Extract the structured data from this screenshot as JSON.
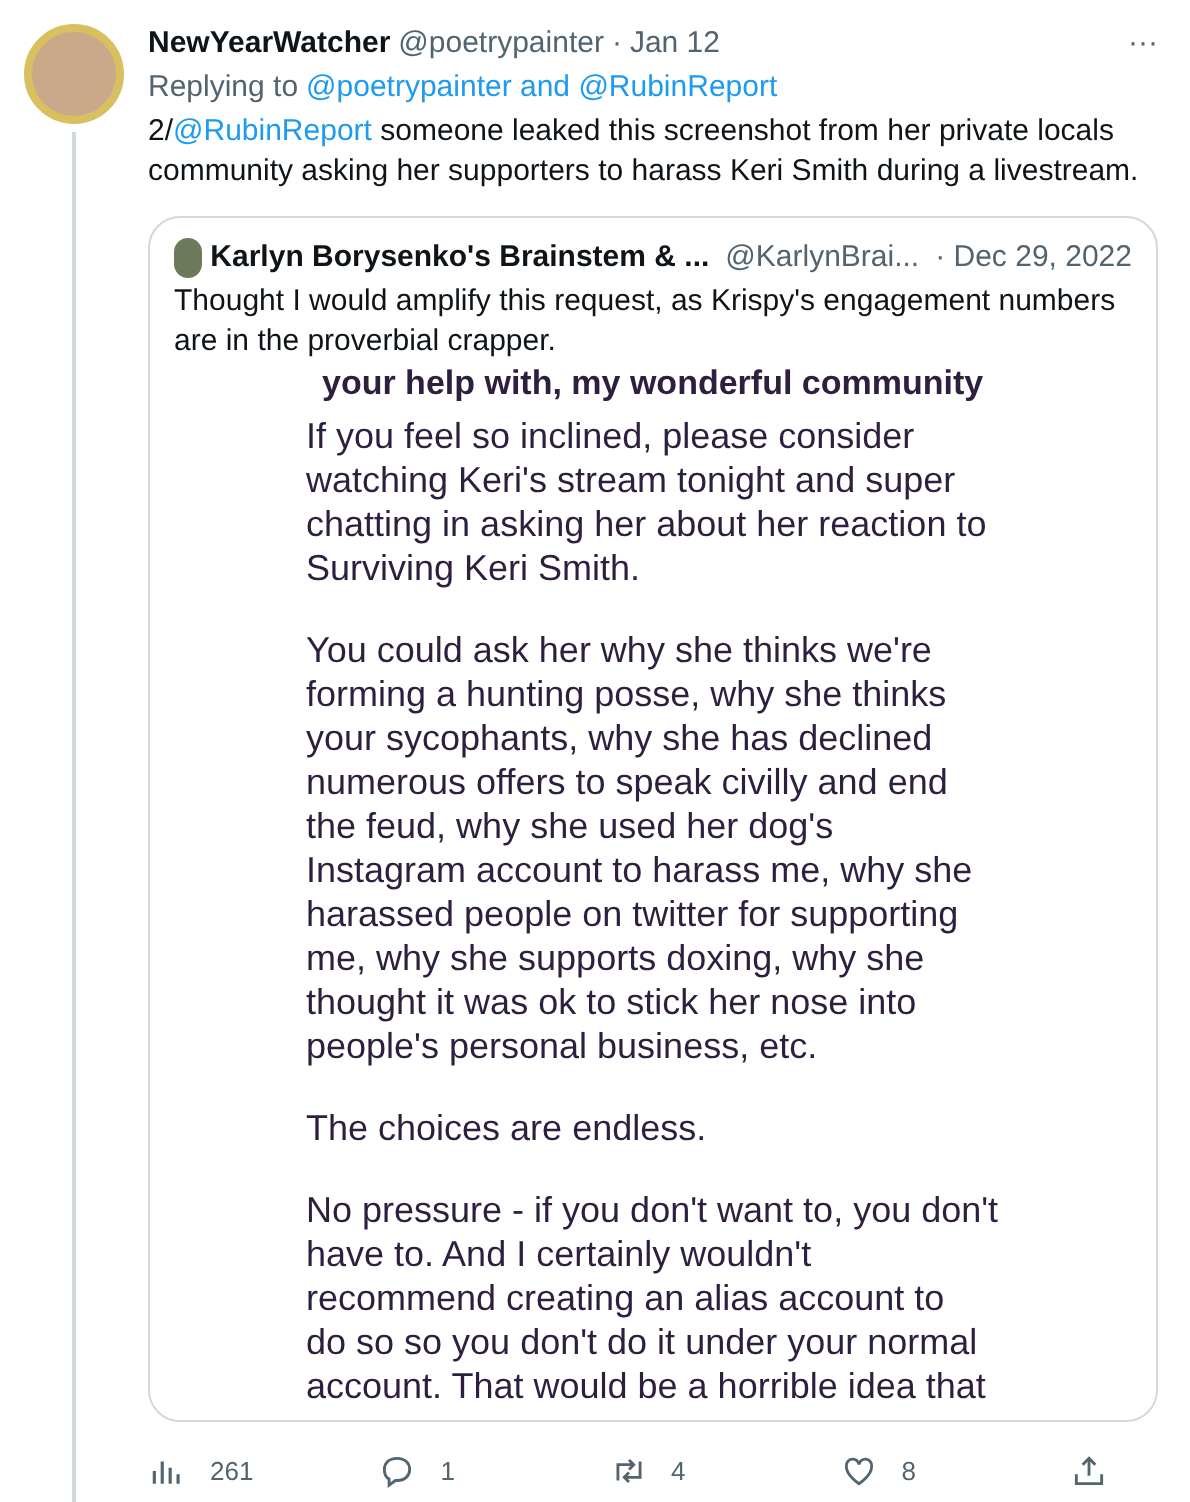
{
  "tweet": {
    "author": "NewYearWatcher",
    "handle": "@poetrypainter",
    "separator": "·",
    "date": "Jan 12",
    "more": "···",
    "replying_prefix": "Replying to",
    "replying_to": "@poetrypainter and @RubinReport",
    "text": "2/",
    "text_mention": "@RubinReport",
    "text_rest": " someone leaked this screenshot from her private locals community asking her supporters to harass Keri Smith during a livestream.",
    "quote": {
      "author": "Karlyn Borysenko's Brainstem & ...",
      "handle": "@KarlynBrai...",
      "date": "· Dec 29, 2022",
      "text": "Thought I would amplify this request, as Krispy's engagement numbers are in the proverbial crapper.",
      "image_paragraphs": [
        {
          "lines": [
            "your help with, my wonderful community"
          ]
        },
        {
          "lines": [
            "If you feel so inclined, please consider",
            "watching Keri's stream tonight and super",
            "chatting in asking her about her reaction to",
            "Surviving Keri Smith."
          ]
        },
        {
          "lines": [
            "You could ask her why she thinks we're",
            "forming a hunting posse, why she thinks",
            "your sycophants, why she has declined",
            "numerous offers to speak civilly and end",
            "the feud, why she used her dog's",
            "Instagram account to harass me, why she",
            "harassed people on twitter for supporting",
            "me, why she supports doxing, why she",
            "thought it was ok to stick her nose into",
            "people's personal business, etc."
          ]
        },
        {
          "lines": [
            "The choices are endless."
          ]
        },
        {
          "lines": [
            "No pressure - if you don't want to, you don't",
            "have to. And I certainly wouldn't",
            "recommend creating an alias account to",
            "do so so you don't do it under your normal",
            "account. That would be a horrible idea that"
          ]
        }
      ]
    },
    "actions": [
      {
        "kind": "views",
        "count": "261"
      },
      {
        "kind": "reply",
        "count": "1"
      },
      {
        "kind": "retweet",
        "count": "4"
      },
      {
        "kind": "like",
        "count": "8"
      },
      {
        "kind": "share"
      }
    ]
  }
}
